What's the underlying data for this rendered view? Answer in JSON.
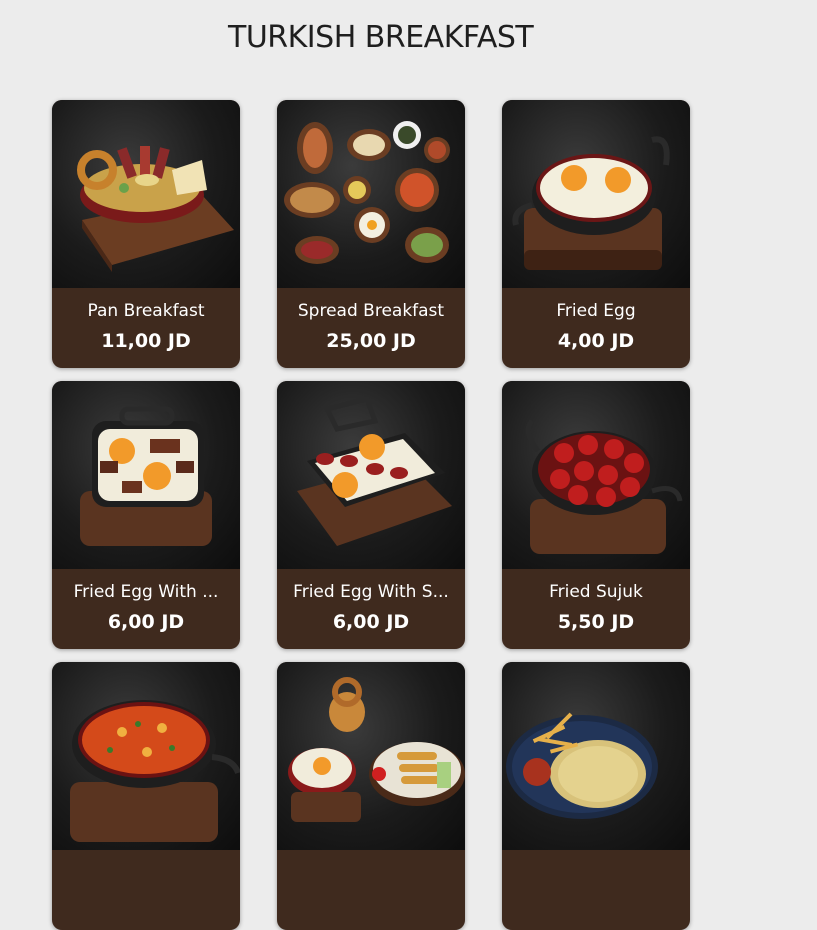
{
  "page": {
    "title": "TURKISH BREAKFAST"
  },
  "items": [
    {
      "name": "Pan Breakfast",
      "price": "11,00 JD",
      "image": "pan-breakfast-image"
    },
    {
      "name": "Spread Breakfast",
      "price": "25,00 JD",
      "image": "spread-breakfast-image"
    },
    {
      "name": "Fried Egg",
      "price": "4,00 JD",
      "image": "fried-egg-image"
    },
    {
      "name": "Fried Egg With ...",
      "price": "6,00 JD",
      "image": "fried-egg-with-meat-image"
    },
    {
      "name": "Fried Egg With S...",
      "price": "6,00 JD",
      "image": "fried-egg-with-sujuk-image"
    },
    {
      "name": "Fried Sujuk",
      "price": "5,50 JD",
      "image": "fried-sujuk-image"
    },
    {
      "name": "",
      "price": "",
      "image": "menemen-image"
    },
    {
      "name": "",
      "price": "",
      "image": "breakfast-platter-image"
    },
    {
      "name": "",
      "price": "",
      "image": "omelette-image"
    }
  ]
}
